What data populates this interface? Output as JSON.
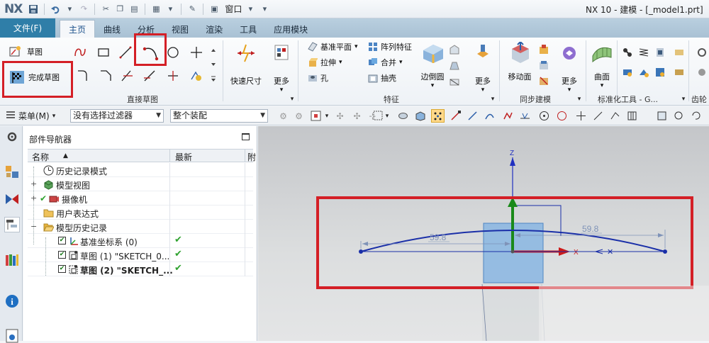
{
  "titlebar": {
    "logo": "NX",
    "window_menu": "窗口",
    "app_title": "NX 10 - 建模 - [_model1.prt]"
  },
  "menu": {
    "file": "文件(F)",
    "tabs": [
      "主页",
      "曲线",
      "分析",
      "视图",
      "渲染",
      "工具",
      "应用模块"
    ],
    "active": "主页"
  },
  "ribbon": {
    "sketch": "草图",
    "finish_sketch": "完成草图",
    "direct_sketch_group": "直接草图",
    "rapid_dimension": "快速尺寸",
    "more": "更多",
    "datum_plane": "基准平面",
    "extrude": "拉伸",
    "hole": "孔",
    "pattern_feature": "阵列特征",
    "unite": "合并",
    "shell": "抽壳",
    "edge_blend": "边倒圆",
    "feature_group": "特征",
    "move_face": "移动面",
    "sync_group": "同步建模",
    "surface": "曲面",
    "standard_tools_group": "标准化工具 - G...",
    "gear_group": "齿轮"
  },
  "selection_bar": {
    "menu": "菜单(M)",
    "filter_value": "没有选择过滤器",
    "scope_value": "整个装配"
  },
  "navigator": {
    "title": "部件导航器",
    "columns": [
      "名称",
      "最新",
      "附"
    ],
    "rows": [
      {
        "label": "历史记录模式",
        "icon": "clock-icon"
      },
      {
        "label": "模型视图",
        "icon": "model-views-icon"
      },
      {
        "label": "摄像机",
        "icon": "camera-icon"
      },
      {
        "label": "用户表达式",
        "icon": "folder-icon"
      },
      {
        "label": "模型历史记录",
        "icon": "folder-open-icon"
      },
      {
        "label": "基准坐标系 (0)",
        "icon": "datum-csys-icon"
      },
      {
        "label": "草图 (1) \"SKETCH_0...",
        "icon": "sketch-icon"
      },
      {
        "label": "草图 (2) \"SKETCH_...",
        "icon": "sketch-icon"
      }
    ]
  },
  "viewport": {
    "axis_z": "Z",
    "axis_x": "X",
    "dim_left": "59.8",
    "dim_right": "59.8"
  },
  "colors": {
    "highlight_red": "#d41f26",
    "sketch_blue": "#1a2fa8",
    "menu_blue": "#2f7ea8"
  }
}
